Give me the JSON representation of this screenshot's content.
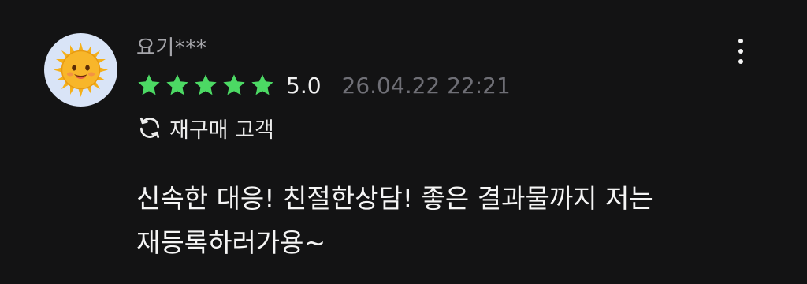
{
  "review": {
    "author": {
      "username": "요기***",
      "avatar_icon": "sun-face-icon"
    },
    "rating": {
      "stars": 5,
      "score": "5.0",
      "star_color": "#4cd964"
    },
    "date": "26.04.22 22:21",
    "badge": {
      "icon": "repeat-arrows-icon",
      "label": "재구매 고객"
    },
    "body": "신속한 대응! 친절한상담! 좋은 결과물까지 저는\n재등록하러가용~",
    "menu_icon": "more-vertical-icon"
  }
}
